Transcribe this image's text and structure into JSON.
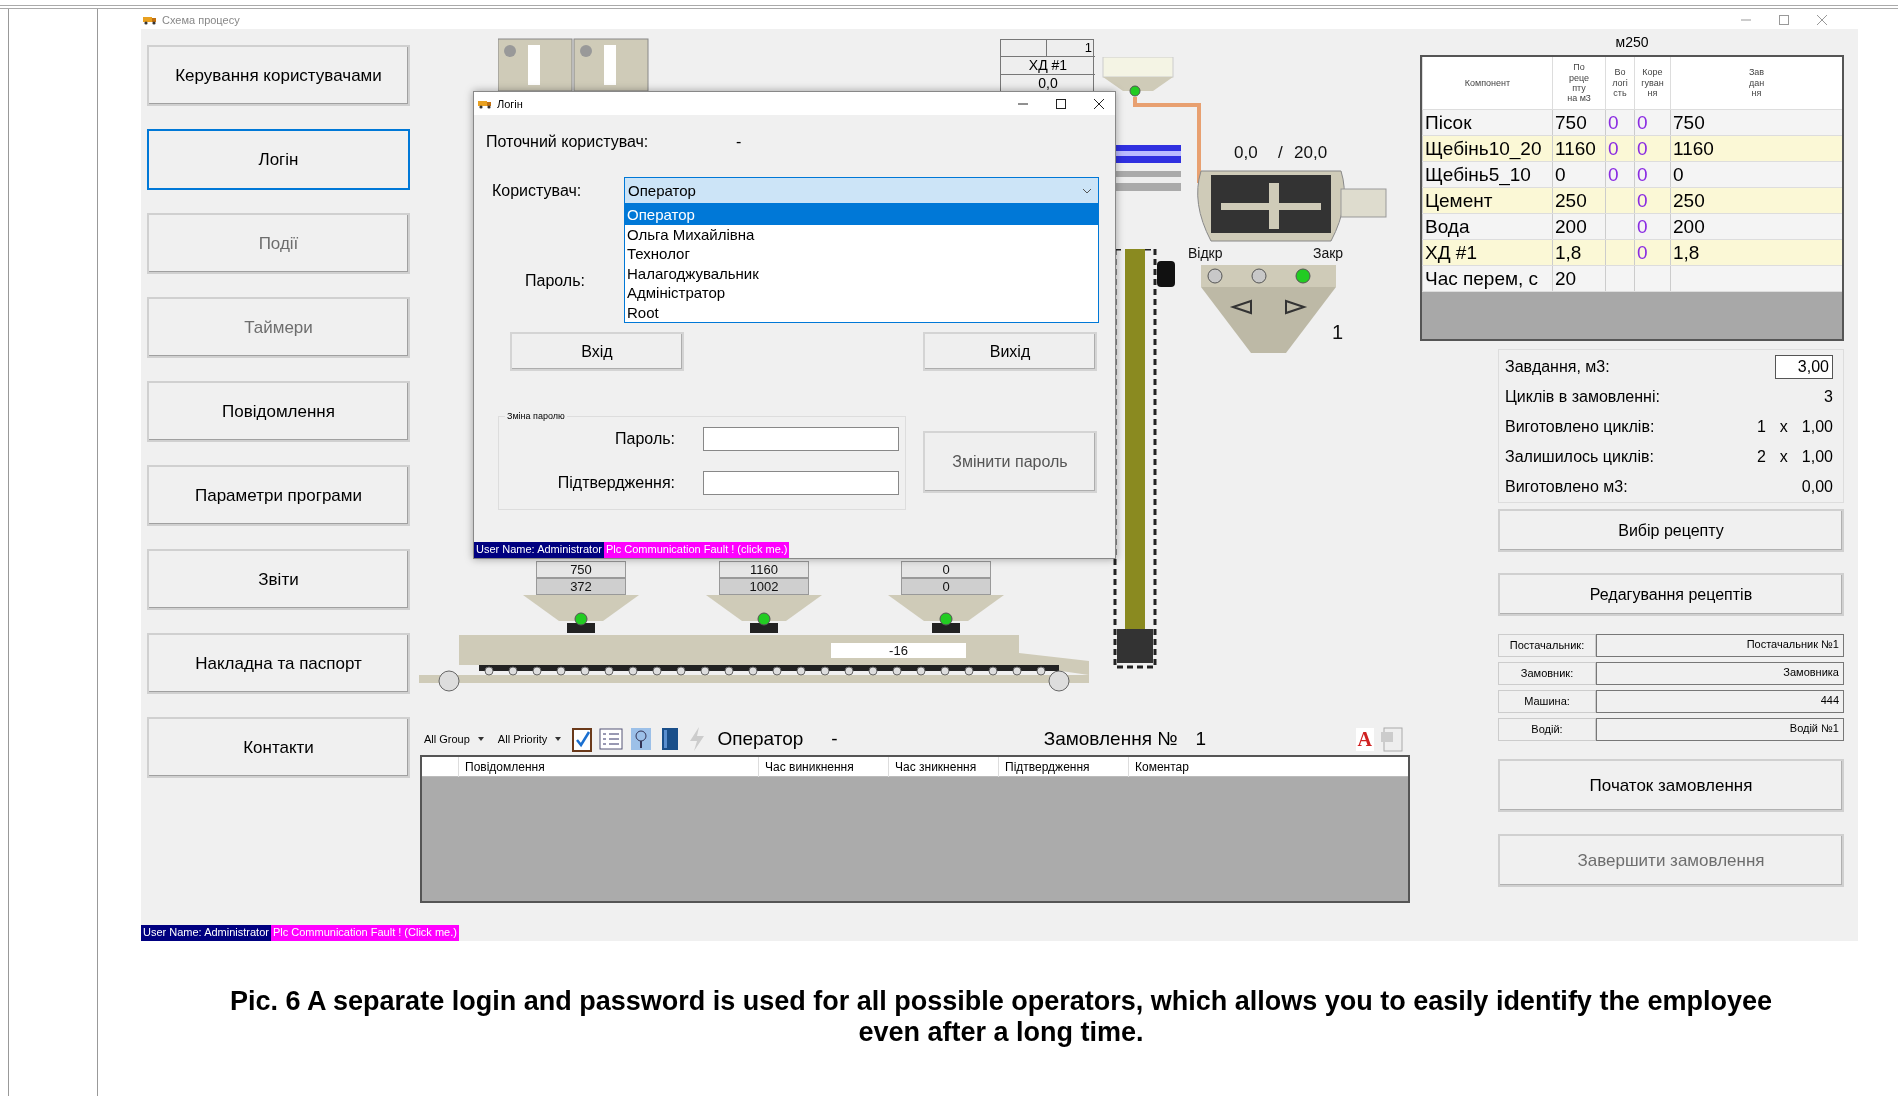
{
  "window": {
    "title": "Схема процесу"
  },
  "nav": [
    {
      "label": "Керування користувачами",
      "selected": false,
      "disabled": false
    },
    {
      "label": "Логін",
      "selected": true,
      "disabled": false
    },
    {
      "label": "Події",
      "selected": false,
      "disabled": true
    },
    {
      "label": "Таймери",
      "selected": false,
      "disabled": true
    },
    {
      "label": "Повідомлення",
      "selected": false,
      "disabled": false
    },
    {
      "label": "Параметри програми",
      "selected": false,
      "disabled": false
    },
    {
      "label": "Звіти",
      "selected": false,
      "disabled": false
    },
    {
      "label": "Накладна та паспорт",
      "selected": false,
      "disabled": false
    },
    {
      "label": "Контакти",
      "selected": false,
      "disabled": false
    }
  ],
  "plant": {
    "dosing_table": {
      "counter": "1",
      "name": "ХД #1",
      "value": "0,0"
    },
    "hopper_lamp_on": true,
    "mixer": {
      "reading": "0,0",
      "separator": "/",
      "target": "20,0",
      "open_label": "Відкр",
      "close_label": "Закр",
      "counter": "1",
      "lamps": [
        {
          "on": false
        },
        {
          "on": false
        },
        {
          "on": true
        }
      ]
    },
    "bins": [
      {
        "target": "750",
        "actual": "372",
        "valve_on": true
      },
      {
        "target": "1160",
        "actual": "1002",
        "valve_on": true
      },
      {
        "target": "0",
        "actual": "0",
        "valve_on": true
      }
    ],
    "belt": {
      "reading": "-16"
    }
  },
  "toolbar": {
    "group_filter": "All Group",
    "priority_filter": "All Priority",
    "operator_label": "Оператор",
    "operator_value": "-",
    "order_label": "Замовлення №",
    "order_value": "1",
    "font_icon": "A"
  },
  "alarm_table": {
    "columns": [
      "Повідомлення",
      "Час виникнення",
      "Час зникнення",
      "Підтвердження",
      "Коментар"
    ]
  },
  "recipe": {
    "name": "м250",
    "columns": [
      "Компонент",
      "По\nреце\nпту\nна м3",
      "Во\nлогі\nсть",
      "Коре\nгуван\nня",
      "Зав\nдан\nня"
    ],
    "rows": [
      {
        "cells": [
          "Пісок",
          "750",
          "0",
          "0",
          "750"
        ],
        "highlighted": false
      },
      {
        "cells": [
          "Щебінь10_20",
          "1160",
          "0",
          "0",
          "1160"
        ],
        "highlighted": true
      },
      {
        "cells": [
          "Щебінь5_10",
          "0",
          "0",
          "0",
          "0"
        ],
        "highlighted": false
      },
      {
        "cells": [
          "Цемент",
          "250",
          "",
          "0",
          "250"
        ],
        "highlighted": true
      },
      {
        "cells": [
          "Вода",
          "200",
          "",
          "0",
          "200"
        ],
        "highlighted": false
      },
      {
        "cells": [
          "ХД #1",
          "1,8",
          "",
          "0",
          "1,8"
        ],
        "highlighted": true
      },
      {
        "cells": [
          "Час перем, с",
          "20",
          "",
          "",
          ""
        ],
        "highlighted": false
      }
    ]
  },
  "order_stats": [
    {
      "label": "Завдання, м3:",
      "kind": "input",
      "values": [
        "3,00"
      ]
    },
    {
      "label": "Циклів в замовленні:",
      "kind": "text",
      "values": [
        "3"
      ]
    },
    {
      "label": "Виготовлено циклів:",
      "kind": "text",
      "values": [
        "1",
        "x",
        "1,00"
      ]
    },
    {
      "label": "Залишилось циклів:",
      "kind": "text",
      "values": [
        "2",
        "x",
        "1,00"
      ]
    },
    {
      "label": "Виготовлено м3:",
      "kind": "text",
      "values": [
        "0,00"
      ]
    }
  ],
  "recipe_buttons": [
    {
      "label": "Вибір рецепту",
      "disabled": false
    },
    {
      "label": "Редагування рецептів",
      "disabled": false
    }
  ],
  "parties": [
    {
      "label": "Постачальник:",
      "value": "Постачальник №1"
    },
    {
      "label": "Замовник:",
      "value": "Замовника"
    },
    {
      "label": "Машина:",
      "value": "444"
    },
    {
      "label": "Водій:",
      "value": "Водій №1"
    }
  ],
  "order_buttons": [
    {
      "label": "Початок замовлення",
      "disabled": false
    },
    {
      "label": "Завершити замовлення",
      "disabled": true
    }
  ],
  "status_bar": {
    "user": "User Name: Administrator",
    "fault": "Plc Communication Fault ! (Click me.)"
  },
  "login_dialog": {
    "title": "Логін",
    "current_user_label": "Поточний користувач:",
    "current_user_value": "-",
    "user_label": "Користувач:",
    "user_value": "Оператор",
    "options": [
      {
        "label": "Оператор",
        "selected": true
      },
      {
        "label": "Ольга Михайлівна",
        "selected": false
      },
      {
        "label": "Технолог",
        "selected": false
      },
      {
        "label": "Налагоджувальник",
        "selected": false
      },
      {
        "label": "Адміністратор",
        "selected": false
      },
      {
        "label": "Root",
        "selected": false
      }
    ],
    "password_label": "Пароль:",
    "login_button": "Вхід",
    "exit_button": "Вихід",
    "change_group": {
      "title": "Зміна паролю",
      "password_label": "Пароль:",
      "confirm_label": "Підтвердження:",
      "button": "Змінити пароль"
    },
    "status_bar": {
      "user": "User Name: Administrator",
      "fault": "Plc Communication Fault ! (click me.)"
    }
  },
  "caption": "Pic. 6 A separate login and password is used for all possible operators, which allows you to easily identify the employee even after a long time."
}
